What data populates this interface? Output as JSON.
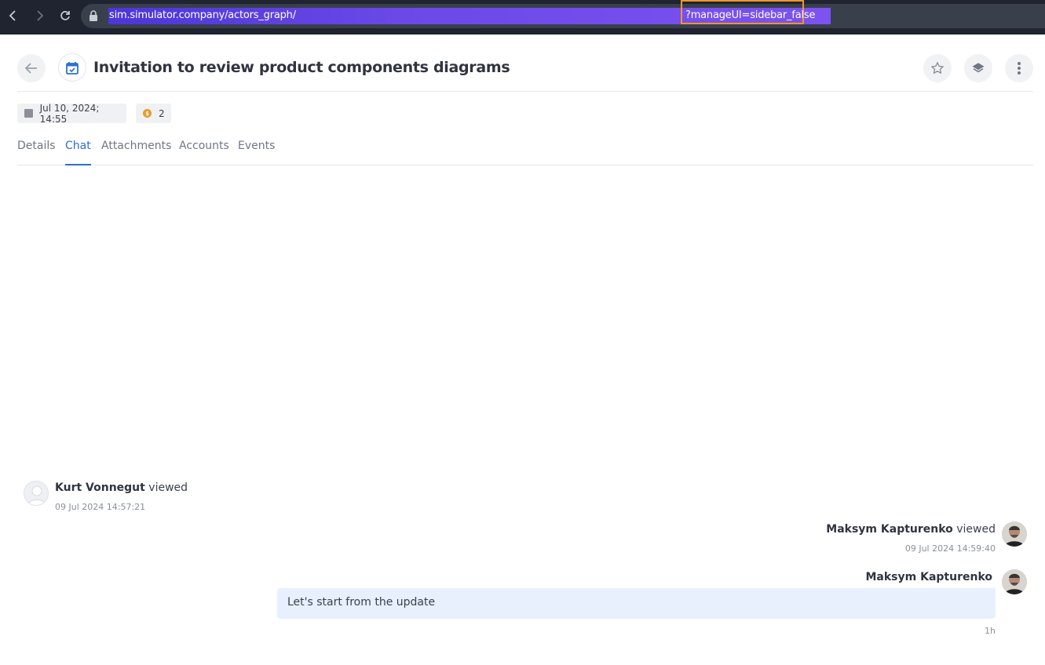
{
  "browser": {
    "url_main": "sim.simulator.company/actors_graph/",
    "url_param": "?manageUI=sidebar_false"
  },
  "header": {
    "title": "Invitation to review product components diagrams",
    "icons": {
      "back": "arrow-left-icon",
      "event": "calendar-check-icon",
      "star": "star-icon",
      "layers": "layers-icon",
      "more": "more-vertical-icon"
    }
  },
  "meta": {
    "date": "Jul 10, 2024; 14:55",
    "coins": "2"
  },
  "tabs": [
    {
      "label": "Details"
    },
    {
      "label": "Chat"
    },
    {
      "label": "Attachments"
    },
    {
      "label": "Accounts"
    },
    {
      "label": "Events"
    }
  ],
  "active_tab": "Chat",
  "chat": {
    "events": [
      {
        "name": "Kurt Vonnegut",
        "action": "viewed",
        "time": "09 Jul 2024 14:57:21"
      },
      {
        "name": "Maksym Kapturenko",
        "action": "viewed",
        "time": "09 Jul 2024 14:59:40"
      }
    ],
    "message": {
      "author": "Maksym Kapturenko",
      "text": "Let's start from the update",
      "age": "1h"
    }
  },
  "colors": {
    "accent": "#2d6fd4",
    "bubble": "#e8f0fd",
    "coin": "#e59a2a",
    "url_highlight": "#f0962b"
  }
}
